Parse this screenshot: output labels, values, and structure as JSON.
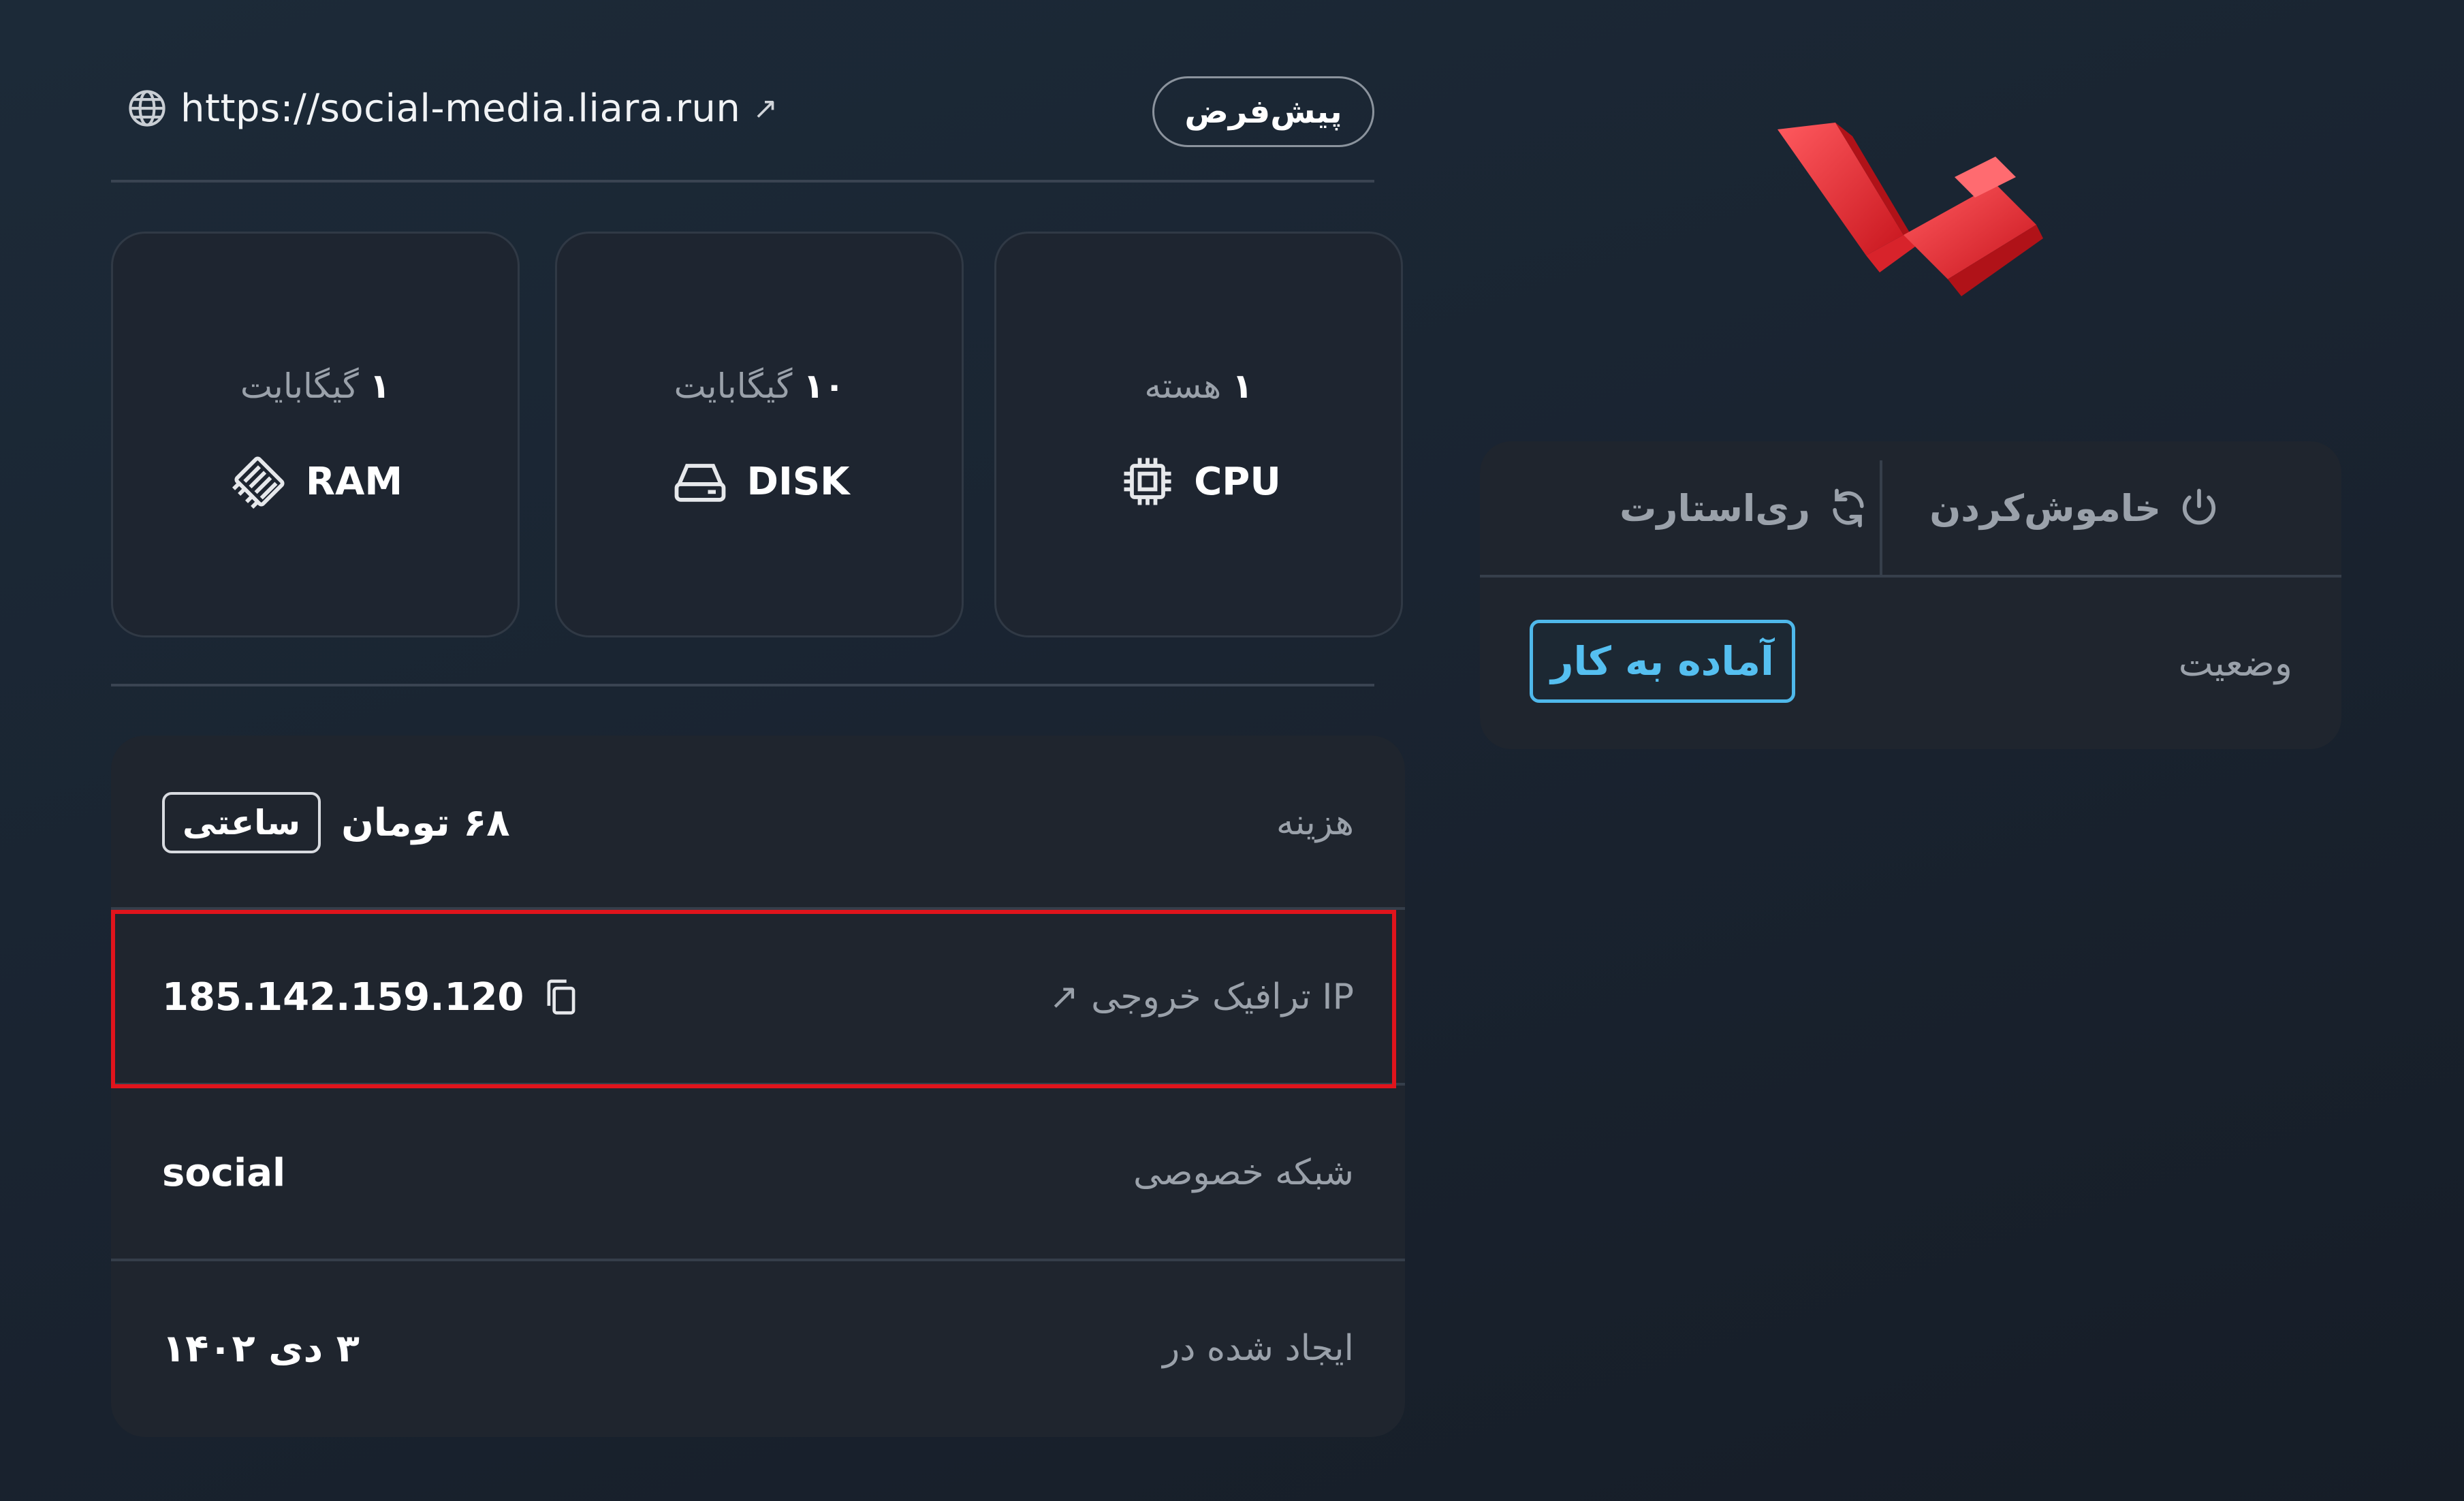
{
  "app": {
    "domain_url": "https://social-media.liara.run",
    "domain_ext_icon": "external-link-icon",
    "default_badge": "پیش‌فرض"
  },
  "resources": [
    {
      "id": "ram",
      "amount_num": "۱",
      "amount_unit": "گیگابایت",
      "label": "RAM",
      "icon": "ram-icon"
    },
    {
      "id": "disk",
      "amount_num": "۱۰",
      "amount_unit": "گیگابایت",
      "label": "DISK",
      "icon": "disk-icon"
    },
    {
      "id": "cpu",
      "amount_num": "۱",
      "amount_unit": "هسته",
      "label": "CPU",
      "icon": "cpu-icon"
    }
  ],
  "details": {
    "cost": {
      "label": "هزینه",
      "value": "۶۸ تومان",
      "period": "ساعتی"
    },
    "outbound_ip": {
      "label": "IP ترافیک خروجی",
      "value": "185.142.159.120"
    },
    "private_network": {
      "label": "شبکه خصوصی",
      "value": "social"
    },
    "created_at": {
      "label": "ایجاد شده در",
      "value": "۳ دی ۱۴۰۲"
    }
  },
  "controls": {
    "shutdown_label": "خاموش‌کردن",
    "restart_label": "ری‌استارت",
    "status_label": "وضعیت",
    "status_value": "آماده به کار"
  },
  "colors": {
    "accent_status": "#55bff0",
    "highlight_border": "#e0141c",
    "logo_red": "#e8333a"
  }
}
